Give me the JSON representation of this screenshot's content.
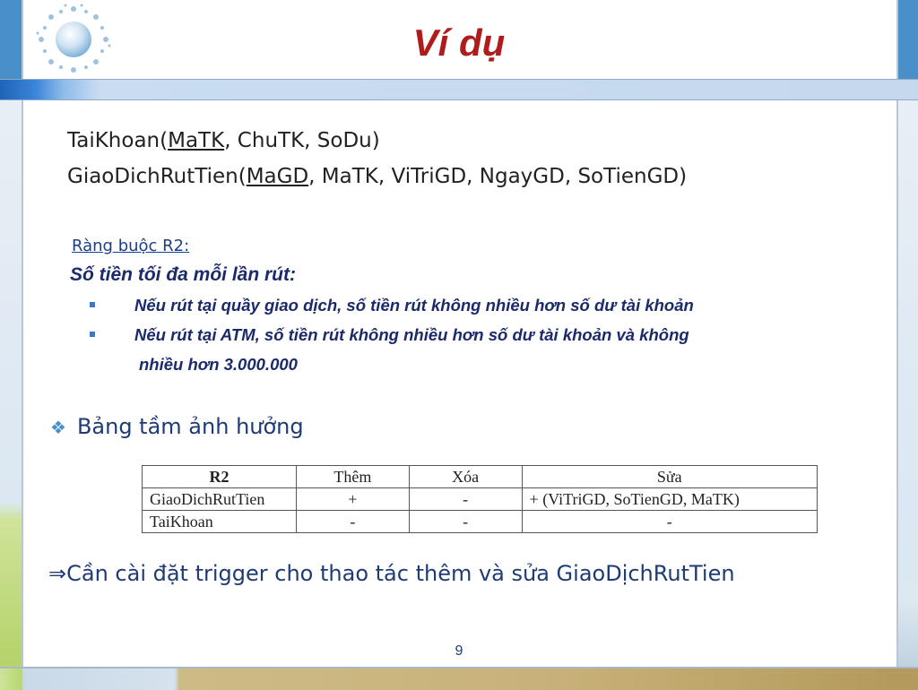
{
  "slide": {
    "title": "Ví dụ",
    "page_number": "9"
  },
  "schemas": [
    {
      "name": "TaiKhoan(",
      "key": "MaTK",
      "rest": ", ChuTK, SoDu)"
    },
    {
      "name": "GiaoDichRutTien(",
      "key": "MaGD",
      "rest": ", MaTK, ViTriGD, NgayGD, SoTienGD)"
    }
  ],
  "constraint": {
    "title": "Ràng buộc R2:",
    "heading": "Số tiền tối đa mỗi lần rút:",
    "rules": [
      "Nếu rút tại quầy giao dịch, số tiền rút không nhiều hơn số dư tài khoản",
      "Nếu rút tại ATM, số tiền rút không nhiều hơn số dư tài khoản và không",
      "nhiều hơn 3.000.000"
    ]
  },
  "section": {
    "bullet_icon": "diamond-dots-icon",
    "label": "Bảng tầm ảnh hưởng"
  },
  "impact_table": {
    "headers": [
      "R2",
      "Thêm",
      "Xóa",
      "Sửa"
    ],
    "rows": [
      [
        "GiaoDichRutTien",
        "+",
        "-",
        "+ (ViTriGD,  SoTienGD, MaTK)"
      ],
      [
        "TaiKhoan",
        "-",
        "-",
        "-"
      ]
    ]
  },
  "conclusion": {
    "arrow": "⇒",
    "text": "Cần cài đặt trigger cho thao tác thêm và sửa GiaoDịchRutTien"
  },
  "colors": {
    "title": "#b01c1c",
    "text": "#1f3b74",
    "accent": "#4a90c8"
  }
}
